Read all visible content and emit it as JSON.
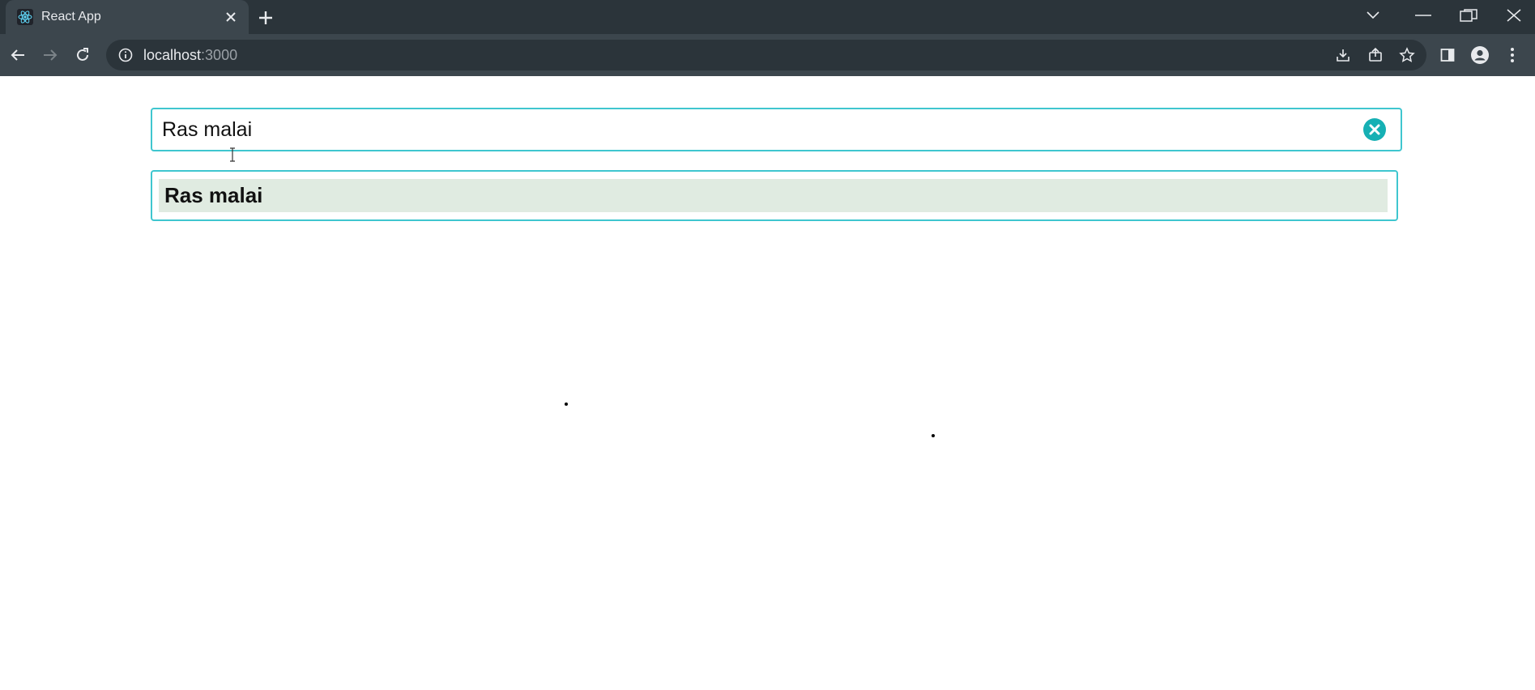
{
  "browser": {
    "tab": {
      "title": "React App",
      "favicon": "react-logo-icon"
    },
    "url": {
      "host": "localhost",
      "port": ":3000"
    },
    "icons": {
      "back": "back-arrow-icon",
      "forward": "forward-arrow-icon",
      "reload": "reload-icon",
      "info": "info-icon",
      "install": "install-app-icon",
      "share": "share-icon",
      "bookmark": "star-icon",
      "sidepanel": "side-panel-icon",
      "profile": "profile-icon",
      "menu": "kebab-menu-icon"
    },
    "colors": {
      "frame": "#2b343a",
      "toolbar": "#3c464d"
    }
  },
  "app": {
    "search": {
      "value": "Ras malai",
      "clear_icon": "clear-circle-icon"
    },
    "results": [
      {
        "label": "Ras malai"
      }
    ],
    "colors": {
      "accent": "#3fc6cf",
      "clear_button": "#16b0b4",
      "highlight": "#e0ebe1"
    }
  }
}
